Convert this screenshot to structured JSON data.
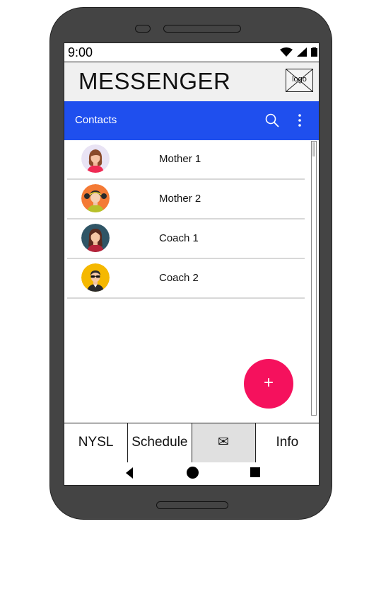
{
  "status_bar": {
    "time": "9:00",
    "icons": [
      "wifi-icon",
      "signal-icon",
      "battery-icon"
    ]
  },
  "header": {
    "title": "MESSENGER",
    "logo_label": "logo"
  },
  "toolbar": {
    "title": "Contacts",
    "search_icon": "search-icon",
    "more_icon": "more-vert-icon",
    "color": "#1f4fee"
  },
  "contacts": [
    {
      "name": "Mother 1",
      "avatar": "woman-brown-hair-avatar"
    },
    {
      "name": "Mother 2",
      "avatar": "girl-pigtails-avatar"
    },
    {
      "name": "Coach 1",
      "avatar": "woman-long-hair-avatar"
    },
    {
      "name": "Coach 2",
      "avatar": "man-sunglasses-avatar"
    }
  ],
  "fab": {
    "label": "+",
    "color": "#f5115d"
  },
  "bottom_nav": [
    {
      "label": "NYSL"
    },
    {
      "label": "Schedule"
    },
    {
      "label": "✉",
      "active": true
    },
    {
      "label": "Info"
    }
  ],
  "system_nav": [
    "back-icon",
    "home-icon",
    "recents-icon"
  ]
}
